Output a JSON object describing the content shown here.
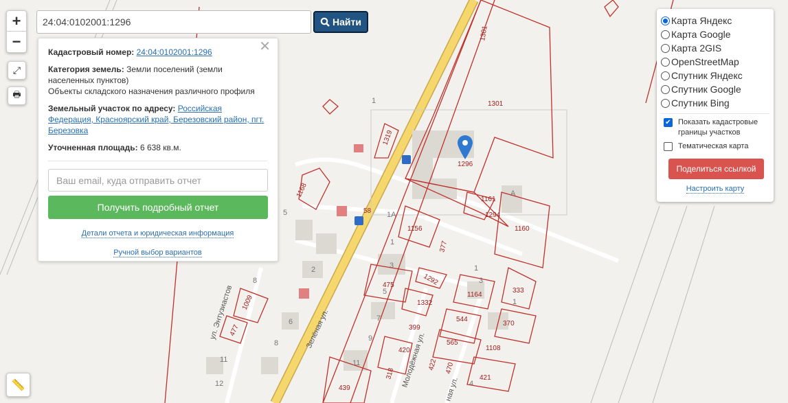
{
  "search": {
    "value": "24:04:0102001:1296",
    "button": "Найти"
  },
  "controls": {
    "zoom_in": "+",
    "zoom_out": "−"
  },
  "popup": {
    "cad_label": "Кадастровый номер:",
    "cad_value": "24:04:0102001:1296",
    "cat_label": "Категория земель:",
    "cat_value": "Земли поселений (земли населенных пунктов)",
    "use": "Объекты складского назначения различного профиля",
    "addr_label": "Земельный участок по адресу:",
    "addr_value": "Российская Федерация, Красноярский край, Березовский район, пгт. Березовка",
    "area_label": "Уточненная площадь:",
    "area_value": "6 638 кв.м.",
    "email_placeholder": "Ваш email, куда отправить отчет",
    "report_button": "Получить подробный отчет",
    "details_link": "Детали отчета и юридическая информация",
    "manual_link": "Ручной выбор вариантов"
  },
  "layers": {
    "options": [
      "Карта Яндекс",
      "Карта Google",
      "Карта 2GIS",
      "OpenStreetMap",
      "Спутник Яндекс",
      "Спутник Google",
      "Спутник Bing"
    ],
    "selected": "Карта Яндекс",
    "show_cadastre": "Показать кадастровые границы участков",
    "thematic": "Тематическая карта",
    "share": "Поделиться ссылкой",
    "configure": "Настроить карту"
  },
  "map": {
    "parcels": [
      "1301",
      "1301",
      "1296",
      "1319",
      "1168",
      "58",
      "1156",
      "377",
      "1161",
      "1294",
      "1160",
      "1292",
      "475",
      "1332",
      "1164",
      "333",
      "370",
      "544",
      "399",
      "565",
      "1108",
      "420",
      "422",
      "470",
      "421",
      "318",
      "439",
      "1009",
      "477"
    ],
    "houses": [
      "1",
      "1А",
      "5",
      "2",
      "3",
      "8",
      "6",
      "7",
      "9",
      "11",
      "12",
      "1",
      "1",
      "4",
      "5",
      "1",
      "3",
      "А",
      "8",
      "11"
    ],
    "streets": [
      "ул. Энтузиастов",
      "Зелёная ул.",
      "Молодёжная ул.",
      "ная ул."
    ]
  },
  "colors": {
    "parcel": "#c0302a",
    "road": "#f5d76e",
    "find": "#215383",
    "report": "#5cb85c",
    "share": "#d9534f"
  }
}
